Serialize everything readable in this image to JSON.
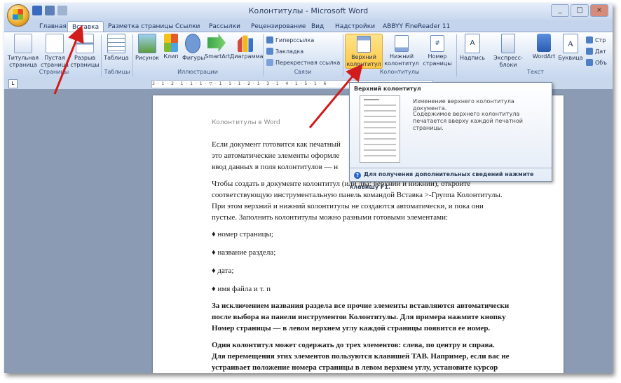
{
  "window": {
    "title": "Колонтитулы - Microsoft Word",
    "controls": [
      "_",
      "□",
      "×"
    ]
  },
  "tabs": [
    "Главная",
    "Вставка",
    "Разметка страницы",
    "Ссылки",
    "Рассылки",
    "Рецензирование",
    "Вид",
    "Надстройки",
    "ABBYY FineReader 11"
  ],
  "active_tab": "Вставка",
  "ribbon": {
    "pages": {
      "label": "Страницы",
      "buttons": [
        "Титульная страница",
        "Пустая страница",
        "Разрыв страницы"
      ]
    },
    "tables": {
      "label": "Таблицы",
      "buttons": [
        "Таблица"
      ]
    },
    "illustrations": {
      "label": "Иллюстрации",
      "buttons": [
        "Рисунок",
        "Клип",
        "Фигуры",
        "SmartArt",
        "Диаграмма"
      ]
    },
    "links": {
      "label": "Связи",
      "buttons": [
        "Гиперссылка",
        "Закладка",
        "Перекрестная ссылка"
      ]
    },
    "headers": {
      "label": "Колонтитулы",
      "buttons": [
        "Верхний колонтитул",
        "Нижний колонтитул",
        "Номер страницы"
      ]
    },
    "text": {
      "label": "Текст",
      "buttons": [
        "Надпись",
        "Экспресс-блоки",
        "WordArt",
        "Буквица"
      ],
      "side": [
        "Стр",
        "Дат",
        "Объ"
      ]
    }
  },
  "tooltip": {
    "title": "Верхний колонтитул",
    "desc1": "Изменение верхнего колонтитула документа.",
    "desc2": "Содержимое верхнего колонтитула печатается вверху каждой печатной страницы.",
    "footer": "Для получения дополнительных сведений нажмите клавишу F1."
  },
  "document": {
    "header": "Колонтитулы в Word",
    "p1_lines": [
      "Если документ готовится как печатный",
      "это автоматические элементы оформле",
      "ввод данных в поля колонтитулов — н"
    ],
    "p2_lines": [
      "Чтобы создать в документе колонтитул (или два: верхний и нижний), откройте",
      "соответствующую инструментальную панель командой Вставка >-Группа Колонтитулы.",
      "При этом верхний и нижний колонтитулы не создаются автоматически, и пока они",
      "пустые. Заполнить колонтитулы можно разными готовыми элементами:"
    ],
    "bullets": [
      "♦ номер страницы;",
      "♦ название раздела;",
      "♦ дата;",
      "♦ имя файла и т. п"
    ],
    "p3_lines": [
      "За исключением  названия раздела  все прочие элементы вставляются автоматически",
      "после выбора на панели инструментов Колонтитулы. Для примера нажмите кнопку",
      "Номер страницы — в левом верхнем углу каждой страницы появится ее номер."
    ],
    "p4_lines": [
      "Один колонтитул может содержать до трех элементов: слева, по центру и справа.",
      "Для перемещения этих элементов пользуются клавишей TAB. Например, если вас не",
      "устраивает положение номера страницы в левом верхнем углу, установите курсор"
    ]
  },
  "colors": {
    "accent": "#c8d7ec",
    "arrow": "#d21b1b",
    "highlight": "#ffc845"
  }
}
